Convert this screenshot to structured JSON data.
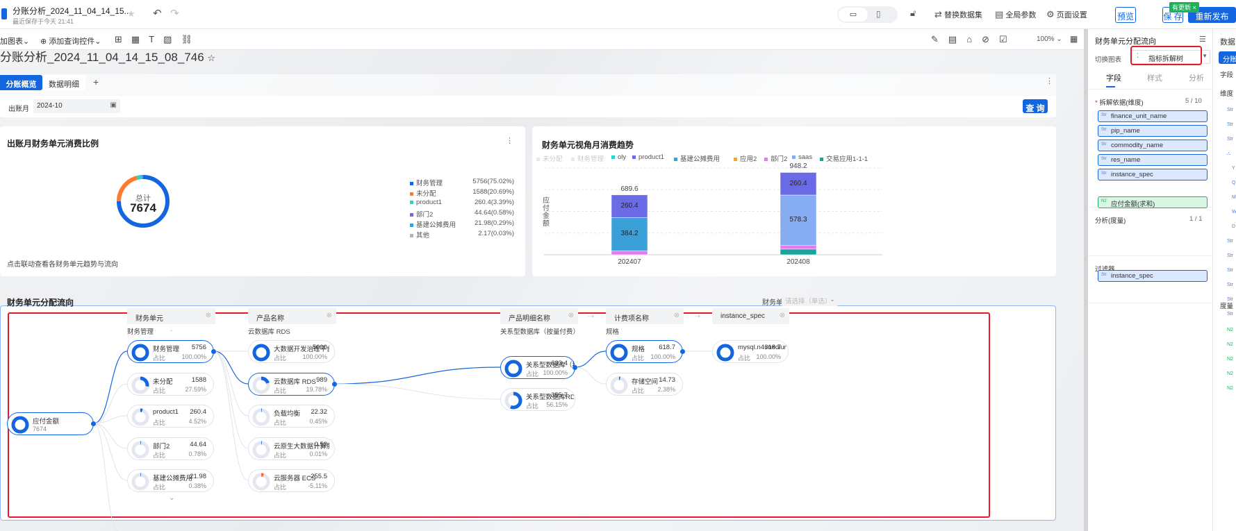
{
  "header": {
    "title": "分账分析_2024_11_04_14_15...",
    "saved": "最近保存于今天 21:41",
    "replace_dataset": "替换数据集",
    "global_params": "全局参数",
    "page_settings": "页面设置",
    "preview": "预览",
    "save": "保 存",
    "republish": "重新发布",
    "update_badge": "有更新"
  },
  "toolbar": {
    "add_chart": "加图表",
    "add_query": "添加查询控件",
    "zoom": "100%"
  },
  "page": {
    "title": "分账分析_2024_11_04_14_15_08_746",
    "tabs": [
      "分账概览",
      "数据明细"
    ],
    "filter_label": "出账月",
    "filter_value": "2024-10",
    "query": "查 询"
  },
  "donut_card": {
    "title": "出账月财务单元消费比例",
    "center_label": "总计",
    "center_value": "7674",
    "footnote": "点击联动查看各财务单元趋势与流向"
  },
  "chart_data": [
    {
      "type": "pie",
      "title": "出账月财务单元消费比例",
      "total": 7674,
      "slices": [
        {
          "name": "财务管理",
          "value": 5756,
          "pct": "75.02%",
          "color": "#1366e0",
          "label": "5756(75.02%)"
        },
        {
          "name": "未分配",
          "value": 1588,
          "pct": "20.69%",
          "color": "#ff7a2f",
          "label": "1588(20.69%)"
        },
        {
          "name": "product1",
          "value": 260.4,
          "pct": "3.39%",
          "color": "#2ed1c6",
          "label": "260.4(3.39%)"
        },
        {
          "name": "部门2",
          "value": 44.64,
          "pct": "0.58%",
          "color": "#6b6be8",
          "label": "44.64(0.58%)"
        },
        {
          "name": "基建公摊费用",
          "value": 21.98,
          "pct": "0.29%",
          "color": "#3ba0d8",
          "label": "21.98(0.29%)"
        },
        {
          "name": "其他",
          "value": 2.17,
          "pct": "0.03%",
          "color": "#b0b4bb",
          "label": "2.17(0.03%)"
        }
      ]
    },
    {
      "type": "bar",
      "stacked": true,
      "title": "财务单元视角月消费趋势",
      "ylabel": "应付金额",
      "xlabel": "",
      "ylim": [
        0,
        1000
      ],
      "grid": true,
      "legend": [
        {
          "name": "未分配",
          "color": "#e6e8eb",
          "faded": true
        },
        {
          "name": "财务管理",
          "color": "#e6e8eb",
          "faded": true
        },
        {
          "name": "oly",
          "color": "#2ed1c6"
        },
        {
          "name": "product1",
          "color": "#6b6be8"
        },
        {
          "name": "基建公摊费用",
          "color": "#3ba0d8"
        },
        {
          "name": "应用2",
          "color": "#f5a623"
        },
        {
          "name": "部门2",
          "color": "#e07cf0"
        },
        {
          "name": "saas",
          "color": "#86acf2"
        },
        {
          "name": "交易应用1-1-1",
          "color": "#1aa59a"
        }
      ],
      "categories": [
        "202407",
        "202408"
      ],
      "totals": [
        "689.6",
        "948.2"
      ],
      "series": [
        {
          "name": "交易应用1-1-1",
          "color": "#1aa59a",
          "values": [
            0,
            64.86
          ]
        },
        {
          "name": "部门2",
          "color": "#e07cf0",
          "values": [
            45.0,
            44.64
          ]
        },
        {
          "name": "基建公摊费用",
          "color": "#3ba0d8",
          "values": [
            384.2,
            0
          ]
        },
        {
          "name": "saas",
          "color": "#86acf2",
          "values": [
            0,
            578.3
          ]
        },
        {
          "name": "product1",
          "color": "#6b6be8",
          "values": [
            260.4,
            260.4
          ]
        }
      ],
      "labels": {
        "基建公摊费用": [
          "384.2",
          ""
        ],
        "saas": [
          "",
          "578.3"
        ],
        "product1": [
          "260.4",
          "260.4"
        ]
      }
    }
  ],
  "tree": {
    "title": "财务单元分配流向",
    "filter_label": "财务单元",
    "filter_placeholder": "请选择（单选）",
    "ratio_label": "占比",
    "columns": [
      {
        "header": "财务单元",
        "selected": "财务管理"
      },
      {
        "header": "产品名称",
        "selected": "云数据库 RDS"
      },
      {
        "header": "产品明细名称",
        "selected": "关系型数据库（按量付费）"
      },
      {
        "header": "计费项名称",
        "selected": "规格"
      },
      {
        "header": "instance_spec",
        "selected": ""
      }
    ],
    "root": {
      "label": "应付金额",
      "value": "7674",
      "fraction": 1
    },
    "nodes": [
      [
        {
          "label": "财务管理",
          "value": "5756",
          "pct": "100.00%",
          "fraction": 1,
          "active": true
        },
        {
          "label": "未分配",
          "value": "1588",
          "pct": "27.59%",
          "fraction": 0.2759
        },
        {
          "label": "product1",
          "value": "260.4",
          "pct": "4.52%",
          "fraction": 0.0452
        },
        {
          "label": "部门2",
          "value": "44.64",
          "pct": "0.78%",
          "fraction": 0.0078
        },
        {
          "label": "基建公摊费用",
          "value": "21.98",
          "pct": "0.38%",
          "fraction": 0.0038
        }
      ],
      [
        {
          "label": "大数据开发治理平台 D...",
          "value": "5000",
          "pct": "100.00%",
          "fraction": 1
        },
        {
          "label": "云数据库 RDS",
          "value": "989",
          "pct": "19.78%",
          "fraction": 0.1978,
          "active": true
        },
        {
          "label": "负载均衡",
          "value": "22.32",
          "pct": "0.45%",
          "fraction": 0.0045
        },
        {
          "label": "云原生大数据计算服务 ...",
          "value": "0.53",
          "pct": "0.01%",
          "fraction": 0.0001
        },
        {
          "label": "云服务器 ECS",
          "value": "-255.5",
          "pct": "-5.11%",
          "fraction": 0.0511,
          "negative": true
        }
      ],
      [
        {
          "label": "关系型数据库（按量付...",
          "value": "633.4",
          "pct": "100.00%",
          "fraction": 1,
          "active": true
        },
        {
          "label": "关系型数据库RDS(包月)",
          "value": "355.7",
          "pct": "56.15%",
          "fraction": 0.5615
        }
      ],
      [
        {
          "label": "规格",
          "value": "618.7",
          "pct": "100.00%",
          "fraction": 1,
          "active": true
        },
        {
          "label": "存储空间",
          "value": "14.73",
          "pct": "2.38%",
          "fraction": 0.0238
        }
      ],
      [
        {
          "label": "mysql.n4.medium.2c",
          "value": "618.7",
          "pct": "100.00%",
          "fraction": 1
        }
      ]
    ]
  },
  "panel": {
    "title": "财务单元分配流向",
    "switch_label": "切换图表",
    "chart_type": "指标拆解树",
    "tabs": [
      "字段",
      "样式",
      "分析"
    ],
    "dim_label": "拆解依据(维度)",
    "dim_count": "5 / 10",
    "dims": [
      "finance_unit_name",
      "pip_name",
      "commodity_name",
      "res_name",
      "instance_spec"
    ],
    "measure_label": "分析(度量)",
    "measure_count": "1 / 1",
    "measure": "应付金额(求和)",
    "filter_label": "过滤器",
    "filters": [
      "instance_spec"
    ]
  },
  "data_panel": {
    "title": "数据",
    "dataset": "分账",
    "fields_label": "字段",
    "dim_label": "维度",
    "measure_label": "度量"
  }
}
